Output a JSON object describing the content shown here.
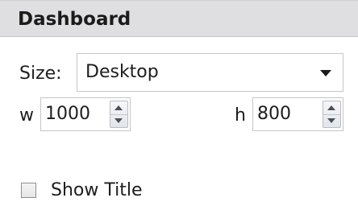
{
  "panel": {
    "title": "Dashboard"
  },
  "size": {
    "label": "Size:",
    "selected": "Desktop"
  },
  "width": {
    "label": "w",
    "value": "1000"
  },
  "height": {
    "label": "h",
    "value": "800"
  },
  "show_title": {
    "label": "Show Title",
    "checked": false
  },
  "icons": {
    "dropdown": "chevron-down-icon",
    "spin_up": "spin-up-icon",
    "spin_down": "spin-down-icon"
  }
}
